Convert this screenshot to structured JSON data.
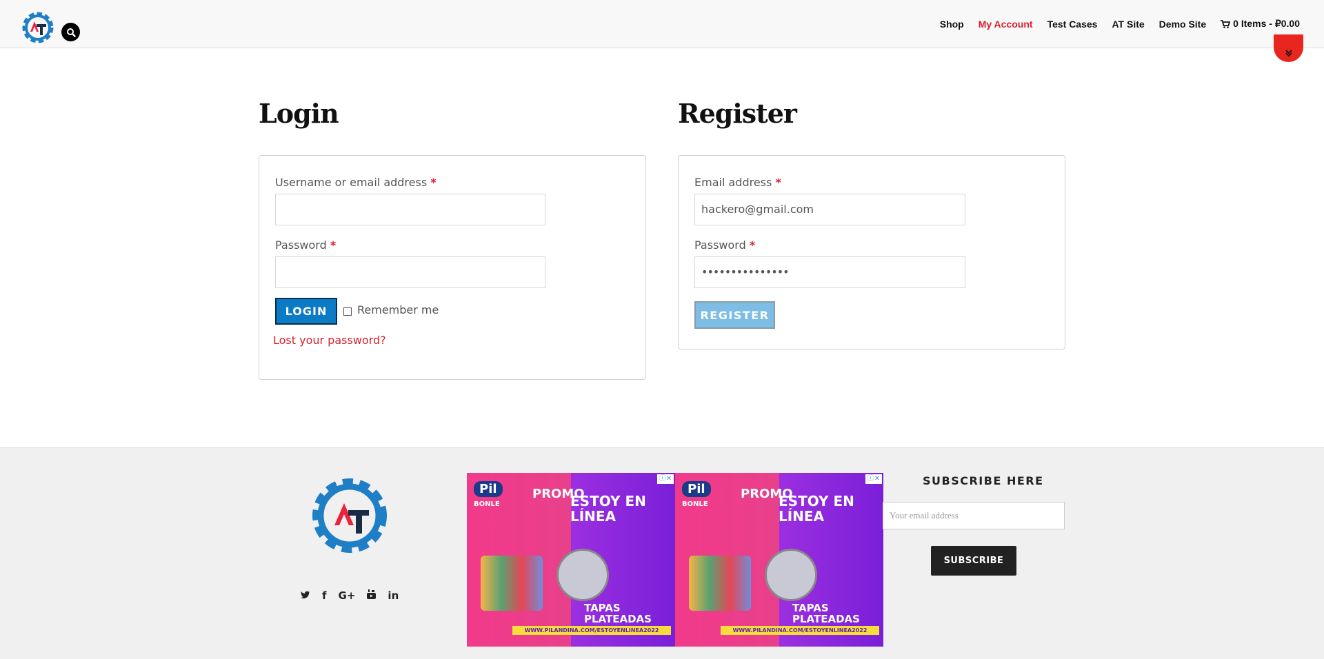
{
  "header": {
    "nav": [
      {
        "label": "Shop",
        "active": false
      },
      {
        "label": "My Account",
        "active": true
      },
      {
        "label": "Test Cases",
        "active": false
      },
      {
        "label": "AT Site",
        "active": false
      },
      {
        "label": "Demo Site",
        "active": false
      }
    ],
    "cart_label": "0 Items - ₽0.00",
    "icons": {
      "search": "search-icon",
      "cart": "cart-icon",
      "scroll": "chevron-double-down-icon"
    }
  },
  "login": {
    "title": "Login",
    "username_label": "Username or email address",
    "username_value": "",
    "password_label": "Password",
    "password_value": "",
    "required_mark": "*",
    "button": "LOGIN",
    "remember": "Remember me",
    "lost": "Lost your password?"
  },
  "register": {
    "title": "Register",
    "email_label": "Email address",
    "email_value": "hackero@gmail.com",
    "password_label": "Password",
    "password_value": "•••••••••••••••",
    "required_mark": "*",
    "button": "REGISTER"
  },
  "footer": {
    "social": [
      "twitter-icon",
      "facebook-icon",
      "google-plus-icon",
      "youtube-icon",
      "linkedin-icon"
    ],
    "social_glyphs": [
      "🐦",
      "f",
      "G+",
      "▶",
      "in"
    ],
    "ad": {
      "brand": "Pil",
      "brand_sub": "BONLE",
      "headline_left": "PROMO",
      "headline_right": "ESTOY EN LÍNEA",
      "tag": "TAPAS PLATEADAS",
      "url": "WWW.PILANDINA.COM/ESTOYENLINEA2022"
    },
    "subscribe_title": "SUBSCRIBE HERE",
    "subscribe_placeholder": "Your email address",
    "subscribe_button": "SUBSCRIBE"
  },
  "colors": {
    "accent": "#d91e2b",
    "primary": "#0a7bc4",
    "logo_blue": "#1f7fc6",
    "logo_dark": "#1a2b44"
  }
}
